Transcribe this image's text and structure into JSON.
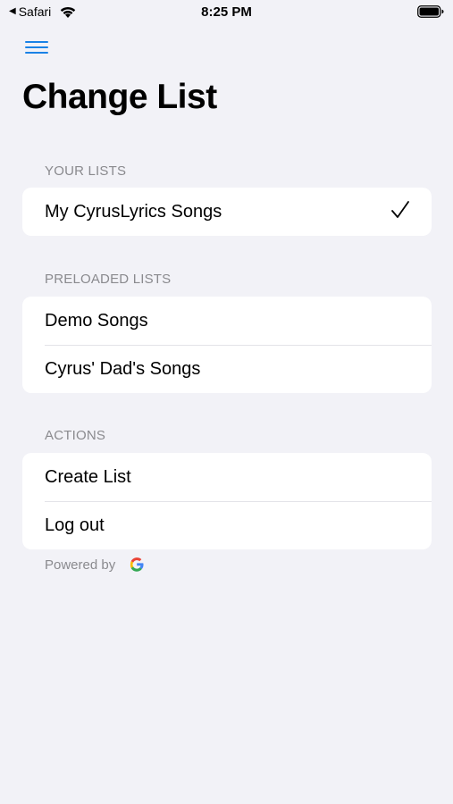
{
  "status_bar": {
    "back_app": "Safari",
    "time": "8:25 PM"
  },
  "page": {
    "title": "Change List"
  },
  "sections": {
    "your_lists": {
      "header": "YOUR LISTS",
      "items": [
        {
          "label": "My CyrusLyrics Songs",
          "selected": true
        }
      ]
    },
    "preloaded_lists": {
      "header": "PRELOADED LISTS",
      "items": [
        {
          "label": "Demo Songs"
        },
        {
          "label": "Cyrus' Dad's Songs"
        }
      ]
    },
    "actions": {
      "header": "ACTIONS",
      "items": [
        {
          "label": "Create List"
        },
        {
          "label": "Log out"
        }
      ]
    }
  },
  "footer": {
    "powered_by": "Powered by",
    "logo": "google-logo"
  },
  "colors": {
    "accent": "#1a82e6",
    "background": "#f2f2f7",
    "section_header": "#8a8a8e"
  },
  "icons": {
    "menu": "hamburger-menu-icon",
    "selected": "checkmark-icon"
  }
}
